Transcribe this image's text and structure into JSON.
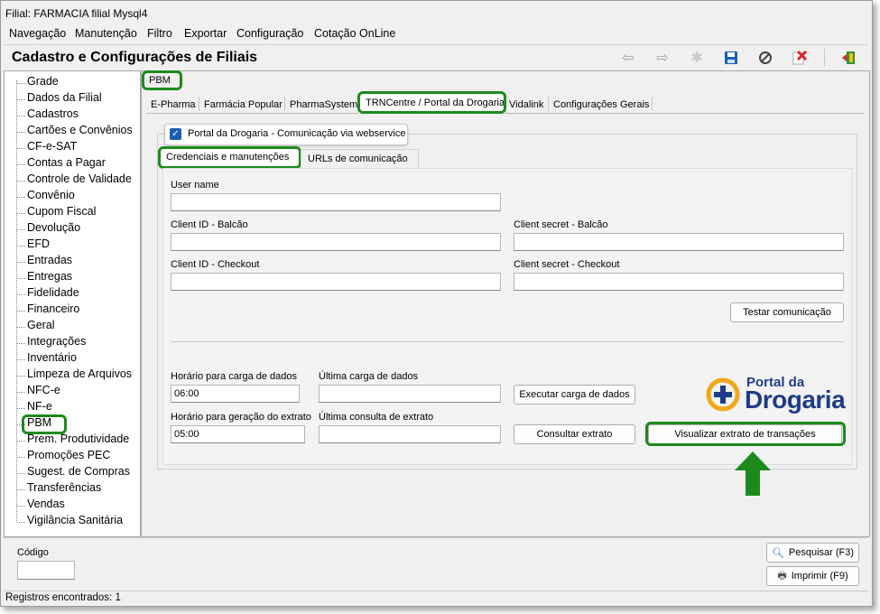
{
  "window": {
    "title": "Filial: FARMACIA filial Mysql4"
  },
  "menu": [
    {
      "label": "Navegação"
    },
    {
      "label": "Manutenção"
    },
    {
      "label": "Filtro"
    },
    {
      "label": "Exportar"
    },
    {
      "label": "Configuração"
    },
    {
      "label": "Cotação OnLine"
    }
  ],
  "header": {
    "title": "Cadastro e Configurações de Filiais"
  },
  "toolbar": {
    "icons": [
      "arrow-left-icon",
      "arrow-right-icon",
      "new-record-icon",
      "save-icon",
      "cancel-icon",
      "delete-icon",
      "exit-icon"
    ]
  },
  "sidebar": {
    "items": [
      "Grade",
      "Dados da Filial",
      "Cadastros",
      "Cartões e Convênios",
      "CF-e-SAT",
      "Contas a Pagar",
      "Controle de Validade",
      "Convênio",
      "Cupom Fiscal",
      "Devolução",
      "EFD",
      "Entradas",
      "Entregas",
      "Fidelidade",
      "Financeiro",
      "Geral",
      "Integrações",
      "Inventário",
      "Limpeza de Arquivos",
      "NFC-e",
      "NF-e",
      "PBM",
      "Prem. Produtividade",
      "Promoções PEC",
      "Sugest. de Compras",
      "Transferências",
      "Vendas",
      "Vigilância Sanitária"
    ],
    "selected": "PBM"
  },
  "main": {
    "section_label": "PBM",
    "tabs": [
      "E-Pharma",
      "Farmácia Popular",
      "PharmaSystem",
      "TRNCentre / Portal da Drogaria",
      "Vidalink",
      "Configurações Gerais"
    ],
    "active_tab": "TRNCentre / Portal da Drogaria",
    "checkbox": {
      "label": "Portal da Drogaria - Comunicação via webservice",
      "checked": true
    },
    "subtabs": [
      "Credenciais e manutenções",
      "URLs de comunicação"
    ],
    "fields": {
      "user_name": {
        "label": "User name",
        "value": ""
      },
      "client_id_balcao": {
        "label": "Client ID - Balcão",
        "value": ""
      },
      "client_secret_balcao": {
        "label": "Client secret - Balcão",
        "value": ""
      },
      "client_id_checkout": {
        "label": "Client ID - Checkout",
        "value": ""
      },
      "client_secret_checkout": {
        "label": "Client secret - Checkout",
        "value": ""
      },
      "horario_carga": {
        "label": "Horário para carga de dados",
        "value": "06:00"
      },
      "ultima_carga": {
        "label": "Última carga de dados",
        "value": ""
      },
      "horario_extrato": {
        "label": "Horário para geração do extrato",
        "value": "05:00"
      },
      "ultima_consulta": {
        "label": "Última consulta de extrato",
        "value": ""
      }
    },
    "buttons": {
      "testar": "Testar comunicação",
      "executar": "Executar carga de dados",
      "consultar": "Consultar extrato",
      "visualizar": "Visualizar extrato de transações"
    },
    "logo": {
      "line1": "Portal da",
      "line2": "Drogaria"
    }
  },
  "bottom": {
    "codigo_label": "Código",
    "codigo_value": "",
    "pesquisar": "Pesquisar (F3)",
    "imprimir": "Imprimir (F9)"
  },
  "status": {
    "text": "Registros encontrados: 1"
  },
  "colors": {
    "highlight": "#1e8a1e",
    "logo_blue": "#1f3c88",
    "logo_orange": "#f2a81d",
    "save_blue": "#1a5fb4",
    "delete_red": "#d9262b"
  }
}
